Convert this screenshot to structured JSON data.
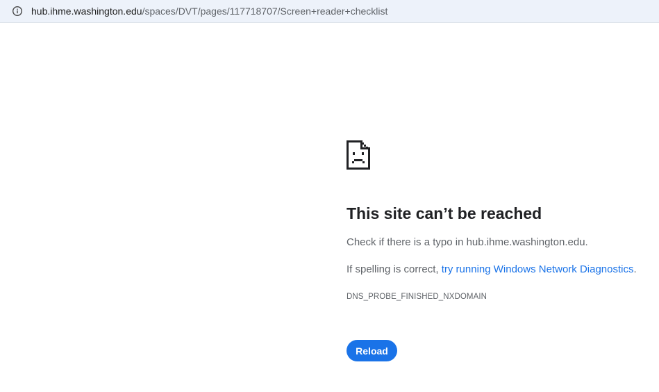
{
  "address_bar": {
    "url_host": "hub.ihme.washington.edu",
    "url_path": "/spaces/DVT/pages/117718707/Screen+reader+checklist",
    "icon": "info-icon"
  },
  "error_page": {
    "icon": "sad-page-icon",
    "title": "This site can’t be reached",
    "typo_message": "Check if there is a typo in hub.ihme.washington.edu.",
    "spelling_prefix": "If spelling is correct, ",
    "diagnostics_link": "try running Windows Network Diagnostics",
    "spelling_suffix": ".",
    "error_code": "DNS_PROBE_FINISHED_NXDOMAIN",
    "reload_label": "Reload"
  },
  "colors": {
    "address_bar_bg": "#edf2fa",
    "link": "#1a73e8",
    "button_bg": "#1a73e8",
    "title_text": "#202124",
    "body_text": "#5f6368"
  }
}
